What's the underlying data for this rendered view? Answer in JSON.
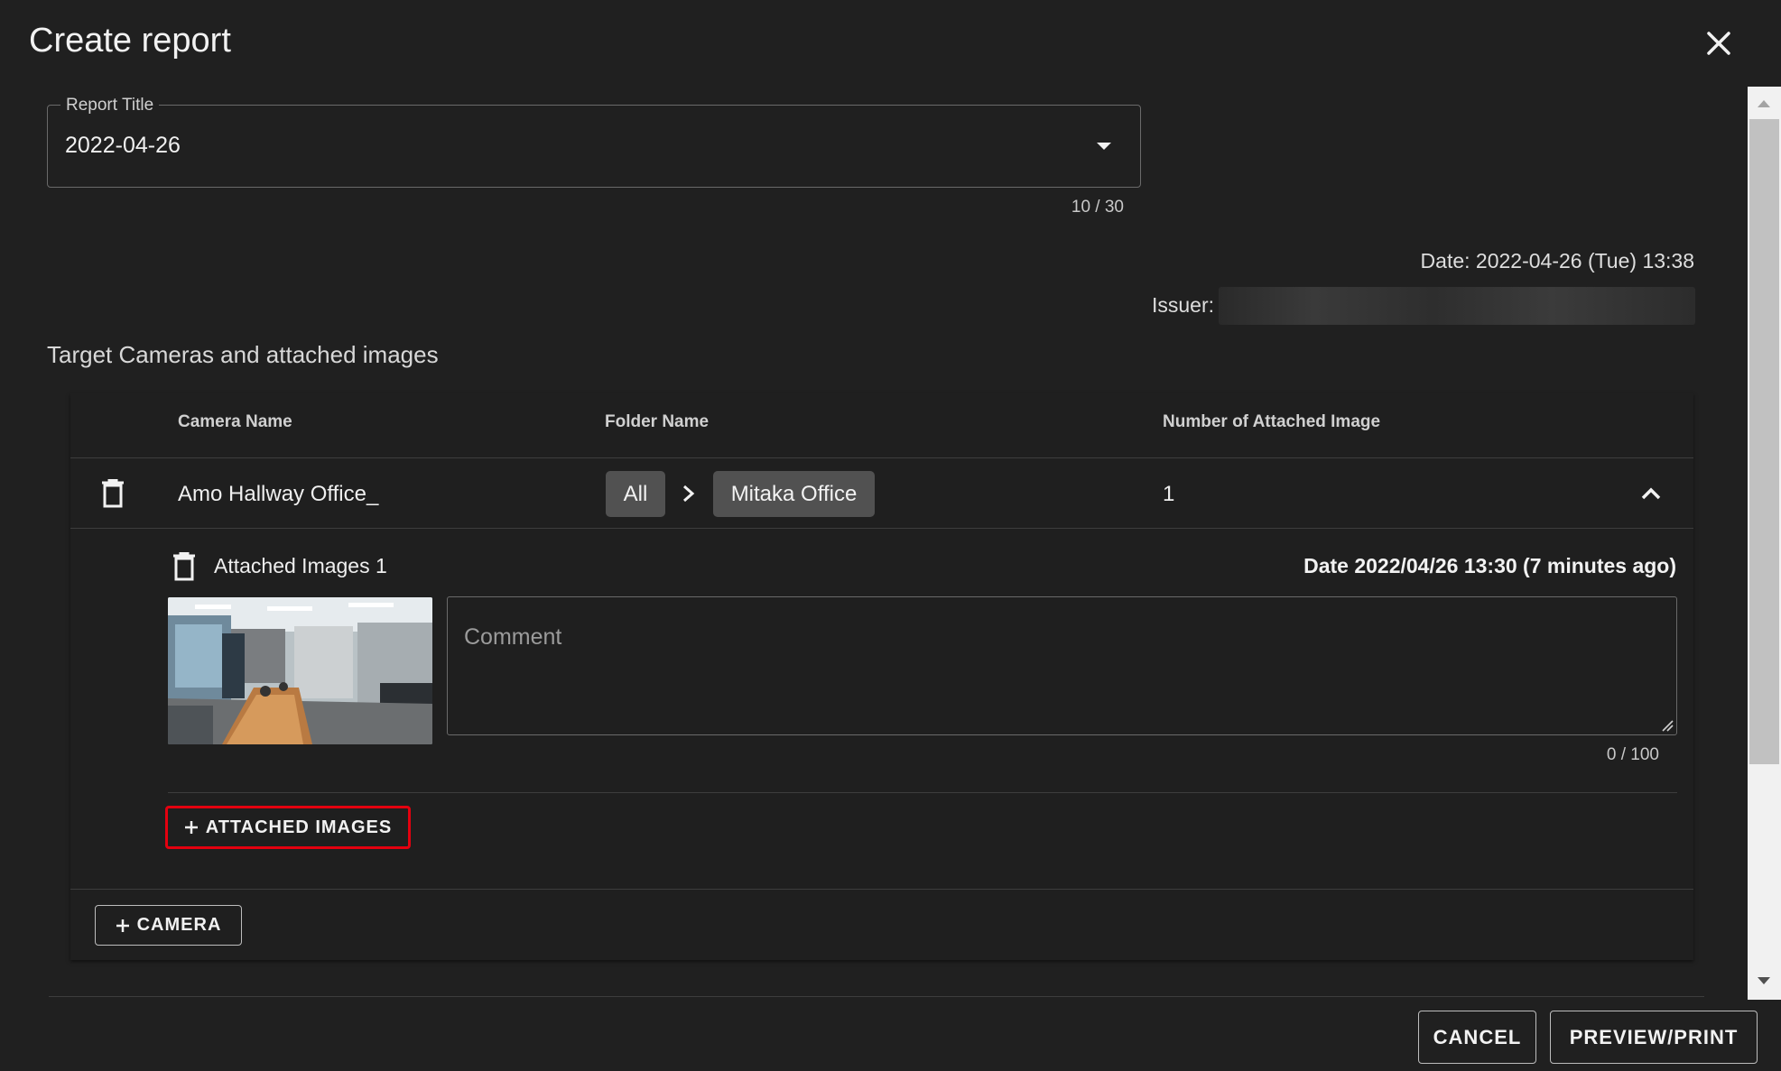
{
  "dialog": {
    "title": "Create report"
  },
  "report_title_field": {
    "label": "Report Title",
    "value": "2022-04-26",
    "counter": "10 / 30"
  },
  "meta": {
    "date": "Date: 2022-04-26 (Tue) 13:38",
    "issuer_label": "Issuer:"
  },
  "section": {
    "title": "Target Cameras and attached images"
  },
  "table": {
    "headers": {
      "camera_name": "Camera Name",
      "folder_name": "Folder Name",
      "attached_count": "Number of Attached Image"
    },
    "rows": [
      {
        "camera_name": "Amo Hallway Office_",
        "folder_path": [
          "All",
          "Mitaka Office"
        ],
        "attached_count": "1",
        "attached_images": [
          {
            "title": "Attached Images 1",
            "date": "Date 2022/04/26 13:30 (7 minutes ago)",
            "comment_placeholder": "Comment",
            "comment_counter": "0 / 100"
          }
        ],
        "add_images_label": "ATTACHED IMAGES"
      }
    ],
    "add_camera_label": "CAMERA"
  },
  "footer": {
    "cancel_label": "CANCEL",
    "preview_label": "PREVIEW/PRINT"
  },
  "icons": {
    "close": "close-icon",
    "dropdown": "dropdown-arrow-icon",
    "trash": "trash-icon",
    "chevron_right": "chevron-right-icon",
    "expand": "chevron-up-icon",
    "plus": "plus-icon"
  },
  "colors": {
    "background": "#202020",
    "chip": "#515151",
    "highlight": "#e3000f"
  }
}
